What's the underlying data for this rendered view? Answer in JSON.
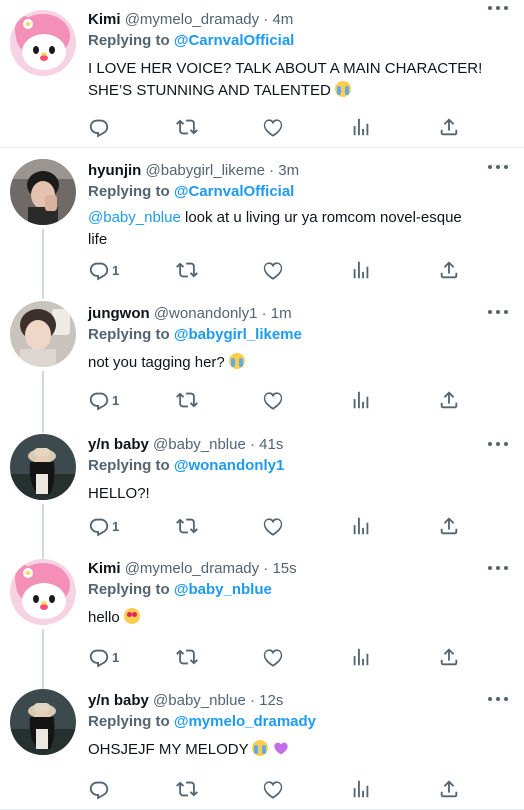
{
  "colors": {
    "accent": "#1d9bf0",
    "muted": "#536471",
    "text": "#0f1419",
    "thread": "#cfd9de"
  },
  "tweets": [
    {
      "name": "Kimi",
      "handle": "@mymelo_dramady",
      "time": "· 4m",
      "replying_prefix": "Replying to ",
      "replying_to": "@CarnvalOfficial",
      "text_lines": [
        "I LOVE HER VOICE? TALK ABOUT A MAIN CHARACTER!",
        "SHE’S STUNNING AND TALENTED"
      ],
      "emoji": "loudly-crying-face",
      "reply_count": "",
      "avatar": "my-melody"
    },
    {
      "name": "hyunjin",
      "handle": "@babygirl_likeme",
      "time": "· 3m",
      "replying_prefix": "Replying to ",
      "replying_to": "@CarnvalOfficial",
      "mention": "@baby_nblue",
      "text_line1_rest": " look at u living ur ya romcom novel-esque",
      "text_line2": "life",
      "reply_count": "1",
      "avatar": "person-dark"
    },
    {
      "name": "jungwon",
      "handle": "@wonandonly1",
      "time": "· 1m",
      "replying_prefix": "Replying to ",
      "replying_to": "@babygirl_likeme",
      "text": "not you tagging her? ",
      "emoji": "loudly-crying-face",
      "reply_count": "1",
      "avatar": "person-light"
    },
    {
      "name": "y/n baby",
      "handle": "@baby_nblue",
      "time": "· 41s",
      "replying_prefix": "Replying to ",
      "replying_to": "@wonandonly1",
      "text": "HELLO?!",
      "reply_count": "1",
      "avatar": "girl-hat"
    },
    {
      "name": "Kimi",
      "handle": "@mymelo_dramady",
      "time": "· 15s",
      "replying_prefix": "Replying to ",
      "replying_to": "@baby_nblue",
      "text": "hello ",
      "emoji": "heart-eyes-face",
      "reply_count": "1",
      "avatar": "my-melody"
    },
    {
      "name": "y/n baby",
      "handle": "@baby_nblue",
      "time": "· 12s",
      "replying_prefix": "Replying to ",
      "replying_to": "@mymelo_dramady",
      "text": "OHSJEJF MY MELODY ",
      "emoji": "loudly-crying-face purple-heart",
      "reply_count": "",
      "avatar": "girl-hat"
    }
  ],
  "icons": [
    "reply-icon",
    "retweet-icon",
    "like-icon",
    "analytics-icon",
    "share-icon",
    "more-icon"
  ]
}
